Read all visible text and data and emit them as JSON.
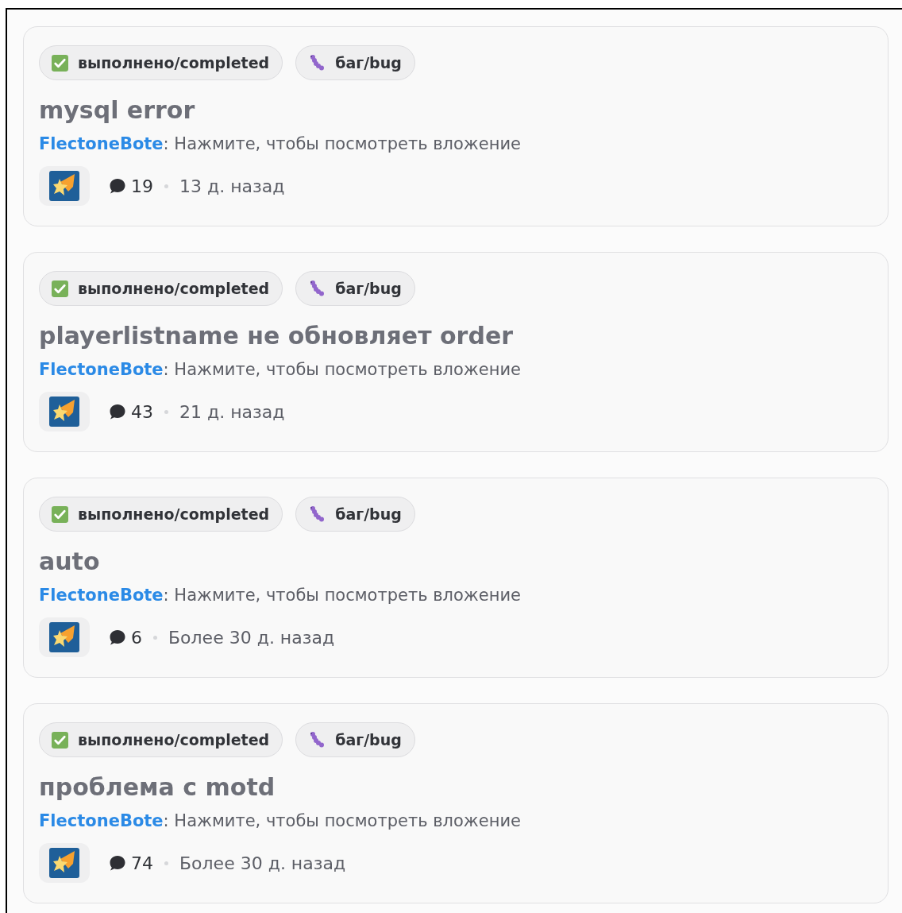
{
  "threads": [
    {
      "tags": [
        {
          "kind": "status",
          "label": "выполнено/completed"
        },
        {
          "kind": "bug",
          "label": "баг/bug"
        }
      ],
      "title": "mysql error",
      "author": "FlectoneBote",
      "preview": ": Нажмите, чтобы посмотреть вложение",
      "comments": "19",
      "time": "13 д. назад"
    },
    {
      "tags": [
        {
          "kind": "status",
          "label": "выполнено/completed"
        },
        {
          "kind": "bug",
          "label": "баг/bug"
        }
      ],
      "title": "playerlistname не обновляет order",
      "author": "FlectoneBote",
      "preview": ": Нажмите, чтобы посмотреть вложение",
      "comments": "43",
      "time": "21 д. назад"
    },
    {
      "tags": [
        {
          "kind": "status",
          "label": "выполнено/completed"
        },
        {
          "kind": "bug",
          "label": "баг/bug"
        }
      ],
      "title": "auto",
      "author": "FlectoneBote",
      "preview": ": Нажмите, чтобы посмотреть вложение",
      "comments": "6",
      "time": "Более 30 д. назад"
    },
    {
      "tags": [
        {
          "kind": "status",
          "label": "выполнено/completed"
        },
        {
          "kind": "bug",
          "label": "баг/bug"
        }
      ],
      "title": "проблема с motd",
      "author": "FlectoneBote",
      "preview": ": Нажмите, чтобы посмотреть вложение",
      "comments": "74",
      "time": "Более 30 д. назад"
    }
  ]
}
